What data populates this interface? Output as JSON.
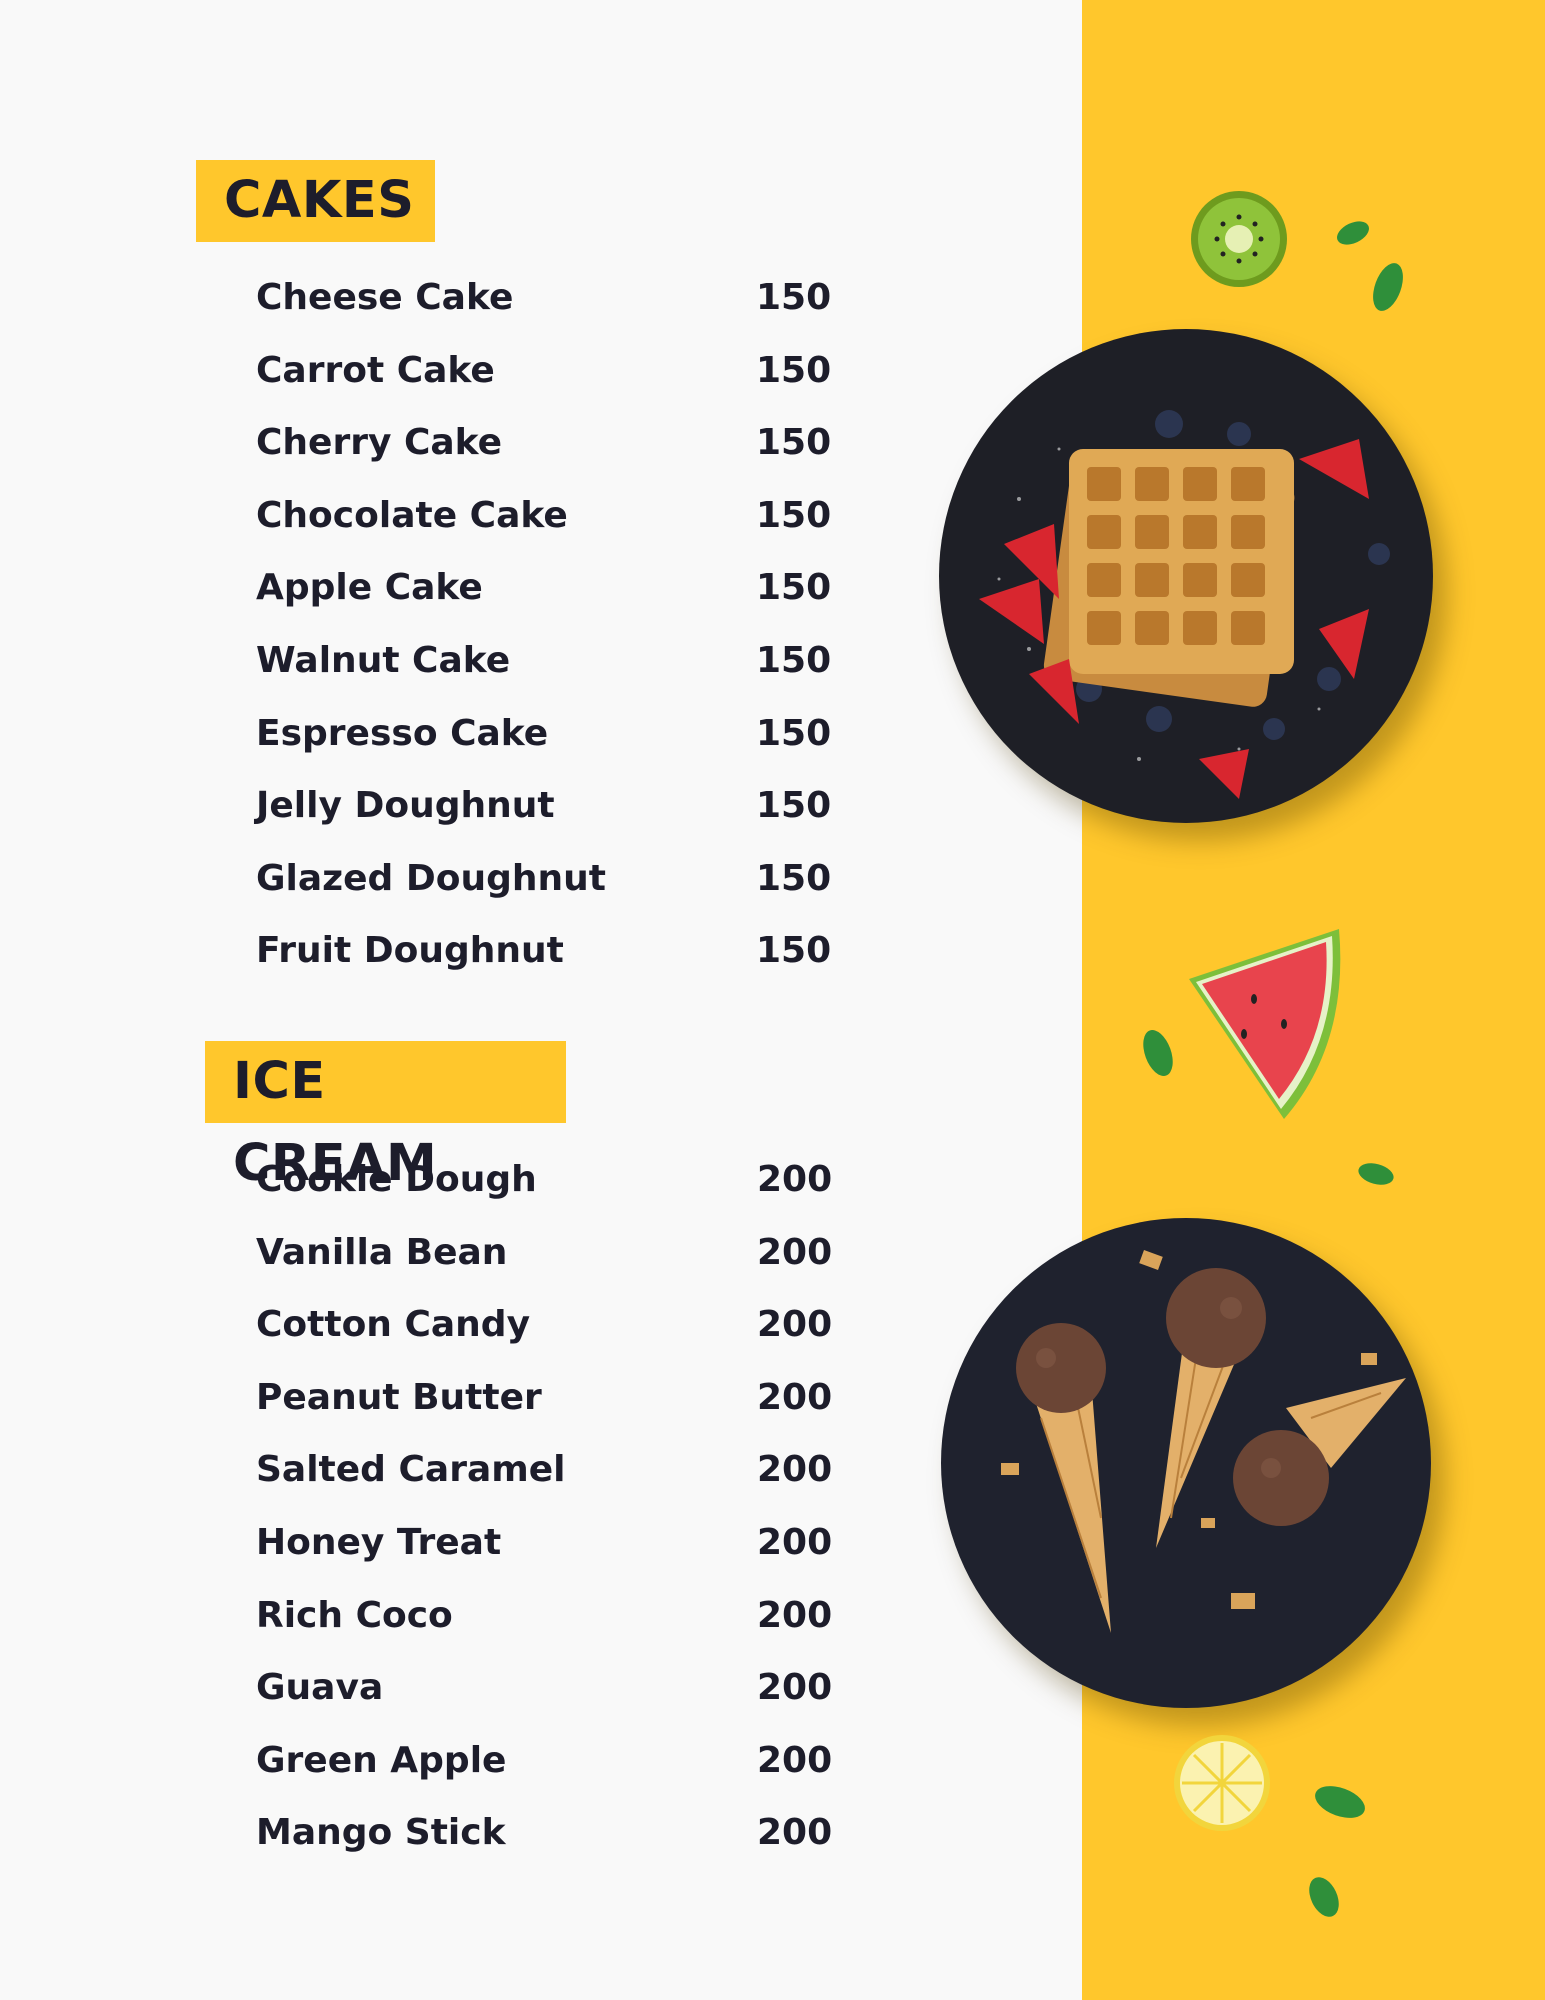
{
  "cakes": {
    "title": "CAKES",
    "items": [
      {
        "name": "Cheese Cake",
        "price": "150"
      },
      {
        "name": "Carrot Cake",
        "price": "150"
      },
      {
        "name": "Cherry Cake",
        "price": "150"
      },
      {
        "name": "Chocolate Cake",
        "price": "150"
      },
      {
        "name": "Apple Cake",
        "price": "150"
      },
      {
        "name": "Walnut Cake",
        "price": "150"
      },
      {
        "name": "Espresso Cake",
        "price": "150"
      },
      {
        "name": "Jelly Doughnut",
        "price": "150"
      },
      {
        "name": "Glazed Doughnut",
        "price": "150"
      },
      {
        "name": "Fruit Doughnut",
        "price": "150"
      }
    ]
  },
  "ice_cream": {
    "title": "ICE CREAM",
    "items": [
      {
        "name": "Cookie Dough",
        "price": "200"
      },
      {
        "name": "Vanilla Bean",
        "price": "200"
      },
      {
        "name": "Cotton Candy",
        "price": "200"
      },
      {
        "name": "Peanut Butter",
        "price": "200"
      },
      {
        "name": "Salted Caramel",
        "price": "200"
      },
      {
        "name": "Honey Treat",
        "price": "200"
      },
      {
        "name": "Rich Coco",
        "price": "200"
      },
      {
        "name": "Guava",
        "price": "200"
      },
      {
        "name": "Green Apple",
        "price": "200"
      },
      {
        "name": "Mango Stick",
        "price": "200"
      }
    ]
  },
  "colors": {
    "accent": "#ffc72c",
    "text": "#1d1d2b",
    "background": "#f9f9f9",
    "plate": "#1e1f26"
  },
  "images": {
    "waffle_plate": "waffle-with-strawberries-photo",
    "icecream_plate": "chocolate-ice-cream-cones-photo",
    "decorations": [
      "kiwi-slice",
      "watermelon-slice",
      "lemon-slice",
      "mint-leaf"
    ]
  }
}
